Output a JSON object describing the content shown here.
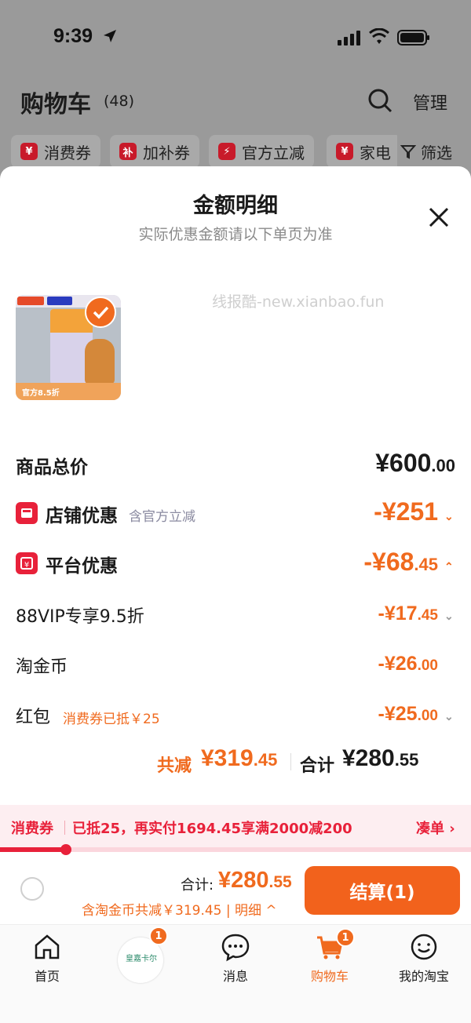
{
  "status_bar": {
    "time": "9:39"
  },
  "header": {
    "title": "购物车",
    "count": "(48)",
    "manage": "管理"
  },
  "filters": [
    {
      "icon_text": "¥",
      "label": "消费券"
    },
    {
      "icon_text": "补",
      "label": "加补券"
    },
    {
      "icon_text": "⚡",
      "label": "官方立减"
    },
    {
      "icon_text": "¥",
      "label": "家电"
    }
  ],
  "filter_button": "筛选",
  "sheet": {
    "title": "金额明细",
    "subtitle": "实际优惠金额请以下单页为准",
    "watermark": "线报酷-new.xianbao.fun",
    "thumb_footer": "官方8.5折"
  },
  "rows": {
    "total_price": {
      "label": "商品总价",
      "amount": "¥600",
      "cents": ".00"
    },
    "store_discount": {
      "label": "店铺优惠",
      "note": "含官方立减",
      "amount": "-¥251",
      "cents": ""
    },
    "platform_discount": {
      "label": "平台优惠",
      "amount": "-¥68",
      "cents": ".45"
    },
    "vip": {
      "label": "88VIP专享9.5折",
      "amount": "-¥17",
      "cents": ".45"
    },
    "coins": {
      "label": "淘金币",
      "amount": "-¥26",
      "cents": ".00"
    },
    "redpacket": {
      "label": "红包",
      "note": "消费券已抵￥25",
      "amount": "-¥25",
      "cents": ".00"
    }
  },
  "totals": {
    "save_label": "共减",
    "save_amount": "¥319",
    "save_cents": ".45",
    "sum_label": "合计",
    "sum_amount": "¥280",
    "sum_cents": ".55"
  },
  "coupon_bar": {
    "tag": "消费券",
    "text": "已抵25，再实付1694.45享满2000减200",
    "link": "凑单 ›",
    "progress": 0.14
  },
  "checkout": {
    "sum_label": "合计:",
    "sum_amount": "¥280",
    "sum_cents": ".55",
    "detail": "含淘金币共减￥319.45 | 明细 ^",
    "button": "结算(1)"
  },
  "tabbar": {
    "items": [
      {
        "label": "首页",
        "icon": "home-icon"
      },
      {
        "label": "",
        "icon": "promo-icon",
        "promo_text": "皇嘉卡尔",
        "badge": "1"
      },
      {
        "label": "消息",
        "icon": "message-icon"
      },
      {
        "label": "购物车",
        "icon": "cart-icon",
        "badge": "1",
        "active": true
      },
      {
        "label": "我的淘宝",
        "icon": "profile-icon"
      }
    ]
  },
  "colors": {
    "accent": "#f06a1e",
    "red": "#e8213a"
  }
}
